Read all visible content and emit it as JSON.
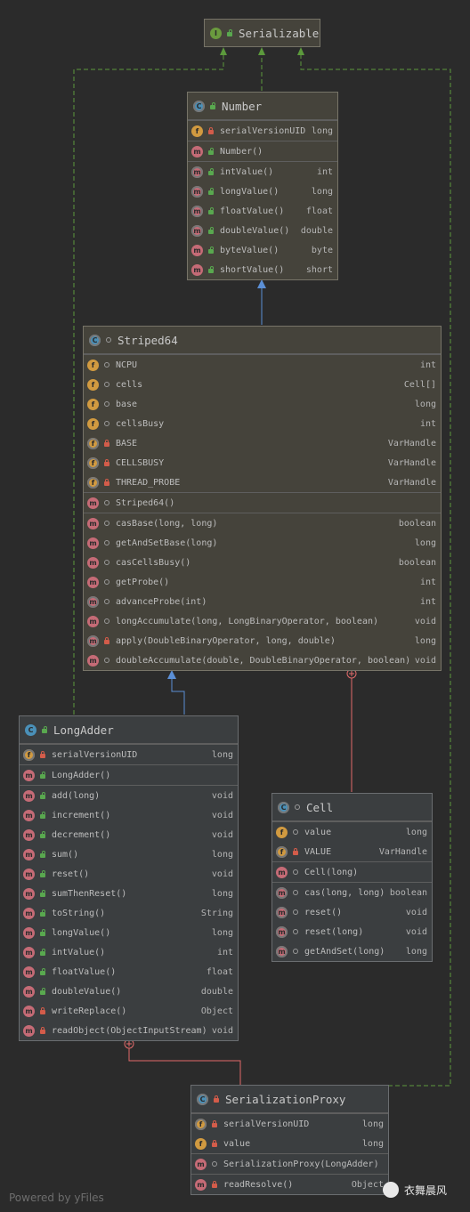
{
  "serializable": {
    "title": "Serializable"
  },
  "number": {
    "title": "Number",
    "fields": [
      {
        "name": "serialVersionUID",
        "type": "long"
      }
    ],
    "constructors": [
      {
        "name": "Number()"
      }
    ],
    "methods": [
      {
        "name": "intValue()",
        "type": "int"
      },
      {
        "name": "longValue()",
        "type": "long"
      },
      {
        "name": "floatValue()",
        "type": "float"
      },
      {
        "name": "doubleValue()",
        "type": "double"
      },
      {
        "name": "byteValue()",
        "type": "byte"
      },
      {
        "name": "shortValue()",
        "type": "short"
      }
    ]
  },
  "striped64": {
    "title": "Striped64",
    "fields": [
      {
        "name": "NCPU",
        "type": "int"
      },
      {
        "name": "cells",
        "type": "Cell[]"
      },
      {
        "name": "base",
        "type": "long"
      },
      {
        "name": "cellsBusy",
        "type": "int"
      },
      {
        "name": "BASE",
        "type": "VarHandle"
      },
      {
        "name": "CELLSBUSY",
        "type": "VarHandle"
      },
      {
        "name": "THREAD_PROBE",
        "type": "VarHandle"
      }
    ],
    "constructors": [
      {
        "name": "Striped64()"
      }
    ],
    "methods": [
      {
        "name": "casBase(long, long)",
        "type": "boolean"
      },
      {
        "name": "getAndSetBase(long)",
        "type": "long"
      },
      {
        "name": "casCellsBusy()",
        "type": "boolean"
      },
      {
        "name": "getProbe()",
        "type": "int"
      },
      {
        "name": "advanceProbe(int)",
        "type": "int"
      },
      {
        "name": "longAccumulate(long, LongBinaryOperator, boolean)",
        "type": "void"
      },
      {
        "name": "apply(DoubleBinaryOperator, long, double)",
        "type": "long"
      },
      {
        "name": "doubleAccumulate(double, DoubleBinaryOperator, boolean)",
        "type": "void"
      }
    ]
  },
  "longadder": {
    "title": "LongAdder",
    "fields": [
      {
        "name": "serialVersionUID",
        "type": "long"
      }
    ],
    "constructors": [
      {
        "name": "LongAdder()"
      }
    ],
    "methods": [
      {
        "name": "add(long)",
        "type": "void"
      },
      {
        "name": "increment()",
        "type": "void"
      },
      {
        "name": "decrement()",
        "type": "void"
      },
      {
        "name": "sum()",
        "type": "long"
      },
      {
        "name": "reset()",
        "type": "void"
      },
      {
        "name": "sumThenReset()",
        "type": "long"
      },
      {
        "name": "toString()",
        "type": "String"
      },
      {
        "name": "longValue()",
        "type": "long"
      },
      {
        "name": "intValue()",
        "type": "int"
      },
      {
        "name": "floatValue()",
        "type": "float"
      },
      {
        "name": "doubleValue()",
        "type": "double"
      },
      {
        "name": "writeReplace()",
        "type": "Object"
      },
      {
        "name": "readObject(ObjectInputStream)",
        "type": "void"
      }
    ]
  },
  "cell": {
    "title": "Cell",
    "fields": [
      {
        "name": "value",
        "type": "long"
      },
      {
        "name": "VALUE",
        "type": "VarHandle"
      }
    ],
    "constructors": [
      {
        "name": "Cell(long)"
      }
    ],
    "methods": [
      {
        "name": "cas(long, long)",
        "type": "boolean"
      },
      {
        "name": "reset()",
        "type": "void"
      },
      {
        "name": "reset(long)",
        "type": "void"
      },
      {
        "name": "getAndSet(long)",
        "type": "long"
      }
    ]
  },
  "proxy": {
    "title": "SerializationProxy",
    "fields": [
      {
        "name": "serialVersionUID",
        "type": "long"
      },
      {
        "name": "value",
        "type": "long"
      }
    ],
    "constructors": [
      {
        "name": "SerializationProxy(LongAdder)"
      }
    ],
    "methods": [
      {
        "name": "readResolve()",
        "type": "Object"
      }
    ]
  },
  "footer": {
    "text": "Powered by yFiles"
  },
  "watermark": {
    "text": "衣舞晨风"
  },
  "colors": {
    "inherit": "#5b8fd6",
    "implements": "#5c9a3c",
    "inner": "#e06a6a"
  }
}
